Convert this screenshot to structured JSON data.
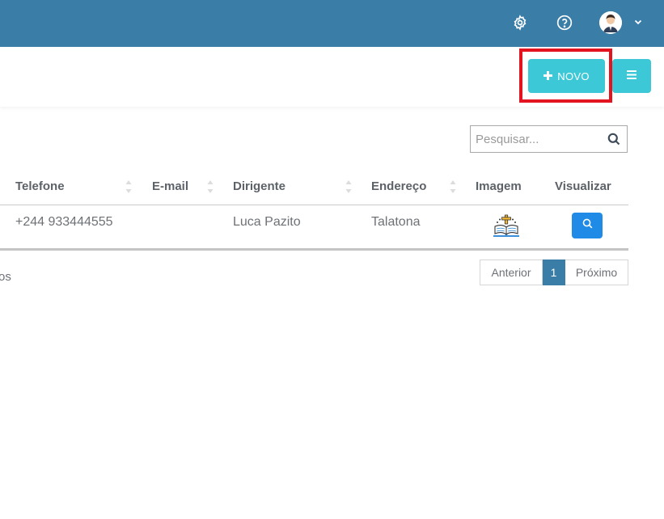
{
  "header": {
    "settings_icon": "gear-icon",
    "help_icon": "help-circle-icon",
    "user_avatar": "user-avatar",
    "dropdown_icon": "chevron-down-icon",
    "background_color": "#3a7ea8"
  },
  "actions": {
    "new_label": "NOVO",
    "new_icon": "plus-icon",
    "menu_icon": "menu-icon",
    "button_color": "#3cc8d6",
    "highlight_color": "#e3141f"
  },
  "search": {
    "placeholder": "Pesquisar...",
    "value": "",
    "icon": "search-icon"
  },
  "table": {
    "columns": [
      "Telefone",
      "E-mail",
      "Dirigente",
      "Endereço",
      "Imagem",
      "Visualizar"
    ],
    "rows": [
      {
        "telefone": "+244 933444555",
        "email": "",
        "dirigente": "Luca Pazito",
        "endereco": "Talatona",
        "imagem": "church-book-icon",
        "visualizar": "search-icon"
      }
    ]
  },
  "footer": {
    "info_text": "os",
    "pagination": {
      "previous": "Anterior",
      "current": "1",
      "next": "Próximo",
      "active_color": "#3a7ea8"
    }
  }
}
